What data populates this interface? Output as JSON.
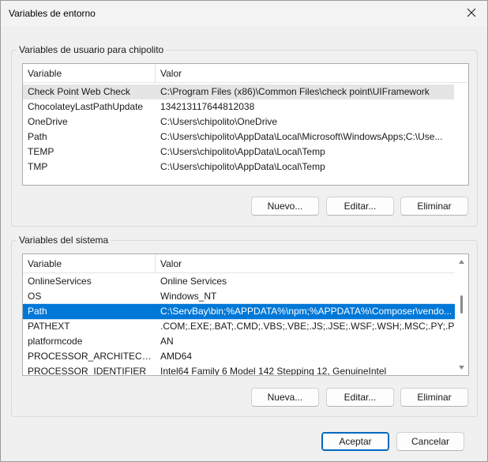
{
  "window": {
    "title": "Variables de entorno"
  },
  "user_group": {
    "legend": "Variables de usuario para chipolito",
    "columns": [
      "Variable",
      "Valor"
    ],
    "rows": [
      {
        "variable": "Check Point Web Check",
        "value": "C:\\Program Files (x86)\\Common Files\\check point\\UIFramework"
      },
      {
        "variable": "ChocolateyLastPathUpdate",
        "value": "134213117644812038"
      },
      {
        "variable": "OneDrive",
        "value": "C:\\Users\\chipolito\\OneDrive"
      },
      {
        "variable": "Path",
        "value": "C:\\Users\\chipolito\\AppData\\Local\\Microsoft\\WindowsApps;C:\\Use..."
      },
      {
        "variable": "TEMP",
        "value": "C:\\Users\\chipolito\\AppData\\Local\\Temp"
      },
      {
        "variable": "TMP",
        "value": "C:\\Users\\chipolito\\AppData\\Local\\Temp"
      }
    ],
    "buttons": {
      "new": "Nuevo...",
      "edit": "Editar...",
      "delete": "Eliminar"
    }
  },
  "system_group": {
    "legend": "Variables del sistema",
    "columns": [
      "Variable",
      "Valor"
    ],
    "rows": [
      {
        "variable": "OnlineServices",
        "value": "Online Services"
      },
      {
        "variable": "OS",
        "value": "Windows_NT"
      },
      {
        "variable": "Path",
        "value": "C:\\ServBay\\bin;%APPDATA%\\npm;%APPDATA%\\Composer\\vendo..."
      },
      {
        "variable": "PATHEXT",
        "value": ".COM;.EXE;.BAT;.CMD;.VBS;.VBE;.JS;.JSE;.WSF;.WSH;.MSC;.PY;.PYW"
      },
      {
        "variable": "platformcode",
        "value": "AN"
      },
      {
        "variable": "PROCESSOR_ARCHITECTURE",
        "value": "AMD64"
      },
      {
        "variable": "PROCESSOR_IDENTIFIER",
        "value": "Intel64 Family 6 Model 142 Stepping 12, GenuineIntel"
      }
    ],
    "selected_variable": "Path",
    "buttons": {
      "new": "Nueva...",
      "edit": "Editar...",
      "delete": "Eliminar"
    }
  },
  "footer": {
    "ok": "Aceptar",
    "cancel": "Cancelar"
  },
  "colors": {
    "selection": "#0078d7",
    "hover_row": "#e5e5e5",
    "primary_border": "#0067c0"
  }
}
